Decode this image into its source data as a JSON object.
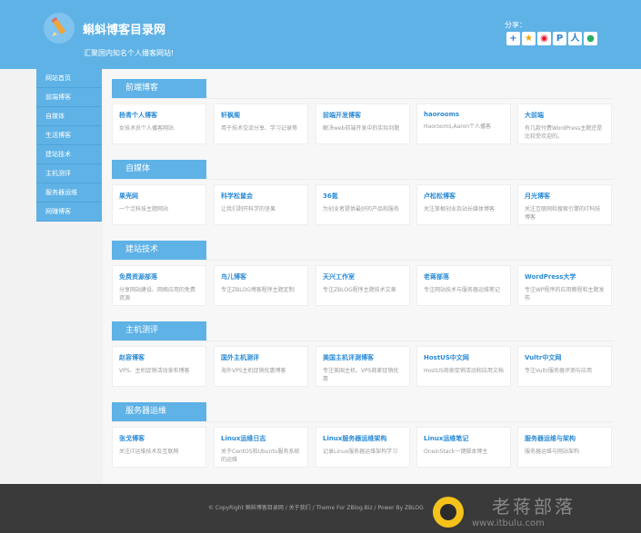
{
  "header": {
    "title": "蝌蚪博客目录网",
    "subtitle": "汇聚国内知名个人播客网站!",
    "share_label": "分享：",
    "share_icons": [
      "plus-icon",
      "qzone-star-icon",
      "weibo-icon",
      "pinterest-icon",
      "people-icon",
      "wechat-icon"
    ]
  },
  "sidebar": {
    "items": [
      {
        "label": "网站首页"
      },
      {
        "label": "前端博客"
      },
      {
        "label": "自媒体"
      },
      {
        "label": "生活博客"
      },
      {
        "label": "建站技术"
      },
      {
        "label": "主机测评"
      },
      {
        "label": "服务器运维"
      },
      {
        "label": "网赚博客"
      }
    ]
  },
  "sections": [
    {
      "title": "前端博客",
      "cards": [
        {
          "title": "杨青个人博客",
          "desc": "女技术员个人播客网站"
        },
        {
          "title": "轩枫阁",
          "desc": "用于技术交流分享、学习记录等"
        },
        {
          "title": "前端开发博客",
          "desc": "解决web前端开发中的实际问题"
        },
        {
          "title": "haorooms",
          "desc": "Haorooms,Aaron个人播客"
        },
        {
          "title": "大前端",
          "desc": "有几款付费WordPress主题还是比较受欢迎的。"
        }
      ]
    },
    {
      "title": "自媒体",
      "cards": [
        {
          "title": "果壳网",
          "desc": "一个泛科技主题网站"
        },
        {
          "title": "科学松鼠会",
          "desc": "让我们剥开科学的坚果"
        },
        {
          "title": "36氪",
          "desc": "为创业者提供最好的产品和服务"
        },
        {
          "title": "卢松松博客",
          "desc": "关注草根创业及站长媒体博客"
        },
        {
          "title": "月光博客",
          "desc": "关注互联网和搜索引擎的IT科技博客"
        }
      ]
    },
    {
      "title": "建站技术",
      "cards": [
        {
          "title": "免费资源部落",
          "desc": "分享网站建设、网络应用的免费资源"
        },
        {
          "title": "鸟儿博客",
          "desc": "专注ZBLOG博客程序主题定制"
        },
        {
          "title": "天兴工作室",
          "desc": "专注ZBLOG程序主题技术文章"
        },
        {
          "title": "老蒋部落",
          "desc": "专注网站技术与服务器运维笔记"
        },
        {
          "title": "WordPress大学",
          "desc": "专注WP程序的应用教程和主题发布"
        }
      ]
    },
    {
      "title": "主机测评",
      "cards": [
        {
          "title": "赵容博客",
          "desc": "VPS、主机促销活动发布博客"
        },
        {
          "title": "国外主机测评",
          "desc": "海外VPS主机促销优惠博客"
        },
        {
          "title": "美国主机评测博客",
          "desc": "专注美国主机、VPS商家促销优惠"
        },
        {
          "title": "HostUS中文网",
          "desc": "HostUS商家促销活动和应用文档"
        },
        {
          "title": "Vultr中文网",
          "desc": "专注Vultr服务器评测与应用"
        }
      ]
    },
    {
      "title": "服务器运维",
      "cards": [
        {
          "title": "张戈博客",
          "desc": "关注IT运维技术及互联网"
        },
        {
          "title": "Linux运维日志",
          "desc": "关于CentOS和Ubuntu服务系统的运维"
        },
        {
          "title": "Linux服务器运维架构",
          "desc": "记录Linux服务器运维架构学习"
        },
        {
          "title": "Linux运维笔记",
          "desc": "OneinStack一键脚本博主"
        },
        {
          "title": "服务器运维与架构",
          "desc": "服务器运维与网站架构"
        }
      ]
    }
  ],
  "footer": {
    "copyright": "© CopyRight 蝌蚪博客目录网 / 关于我们 / Theme For ZBlog.Biz / Power By ZBLOG"
  },
  "watermark": {
    "name": "老蒋部落",
    "url": "www.itbulu.com"
  },
  "colors": {
    "accent": "#5eb2e6",
    "link": "#2a8bd6",
    "footer_bg": "#3a3a3a"
  }
}
